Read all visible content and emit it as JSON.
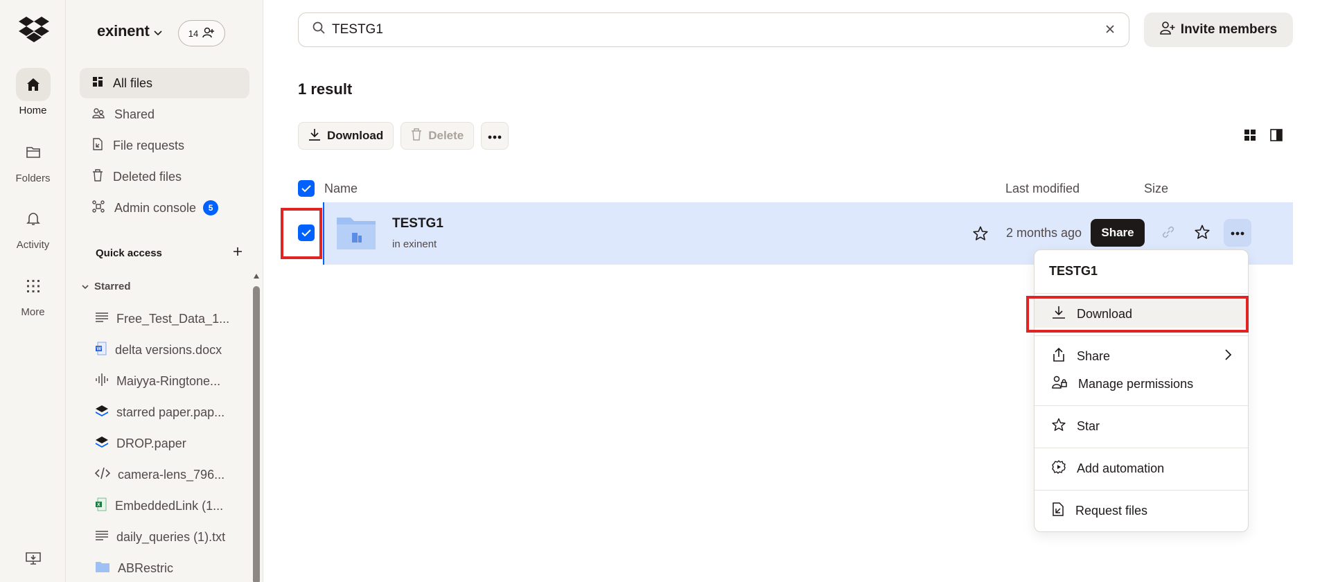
{
  "rail": {
    "items": [
      {
        "label": "Home",
        "icon": "home-icon"
      },
      {
        "label": "Folders",
        "icon": "folder-icon"
      },
      {
        "label": "Activity",
        "icon": "bell-icon"
      },
      {
        "label": "More",
        "icon": "grid-icon"
      }
    ]
  },
  "sidebar": {
    "team_name": "exinent",
    "member_count": "14",
    "nav": [
      {
        "label": "All files"
      },
      {
        "label": "Shared"
      },
      {
        "label": "File requests"
      },
      {
        "label": "Deleted files"
      },
      {
        "label": "Admin console",
        "badge": "5"
      }
    ],
    "quick_access_label": "Quick access",
    "starred_label": "Starred",
    "starred": [
      {
        "label": "Free_Test_Data_1...",
        "icon": "text-file-icon"
      },
      {
        "label": "delta versions.docx",
        "icon": "word-doc-icon"
      },
      {
        "label": "Maiyya-Ringtone...",
        "icon": "audio-icon"
      },
      {
        "label": "starred paper.pap...",
        "icon": "paper-doc-icon"
      },
      {
        "label": "DROP.paper",
        "icon": "paper-doc-icon"
      },
      {
        "label": "camera-lens_796...",
        "icon": "code-file-icon"
      },
      {
        "label": "EmbeddedLink (1...",
        "icon": "excel-icon"
      },
      {
        "label": "daily_queries (1).txt",
        "icon": "text-file-icon"
      },
      {
        "label": "ABRestric",
        "icon": "folder-icon"
      }
    ]
  },
  "search": {
    "value": "TESTG1"
  },
  "invite_label": "Invite members",
  "results_title": "1 result",
  "toolbar": {
    "download_label": "Download",
    "delete_label": "Delete"
  },
  "table": {
    "col_name": "Name",
    "col_modified": "Last modified",
    "col_size": "Size",
    "rows": [
      {
        "name": "TESTG1",
        "location": "in exinent",
        "modified": "2 months ago",
        "share_label": "Share"
      }
    ]
  },
  "menu": {
    "title": "TESTG1",
    "items": [
      {
        "label": "Download",
        "icon": "download-icon"
      },
      {
        "label": "Share",
        "icon": "share-icon"
      },
      {
        "label": "Manage permissions",
        "icon": "permissions-icon"
      },
      {
        "label": "Star",
        "icon": "star-icon"
      },
      {
        "label": "Add automation",
        "icon": "automation-icon"
      },
      {
        "label": "Request files",
        "icon": "request-files-icon"
      }
    ]
  },
  "colors": {
    "accent": "#0061fe",
    "highlight_box": "#e02424",
    "row_selected": "#dde8fc"
  }
}
